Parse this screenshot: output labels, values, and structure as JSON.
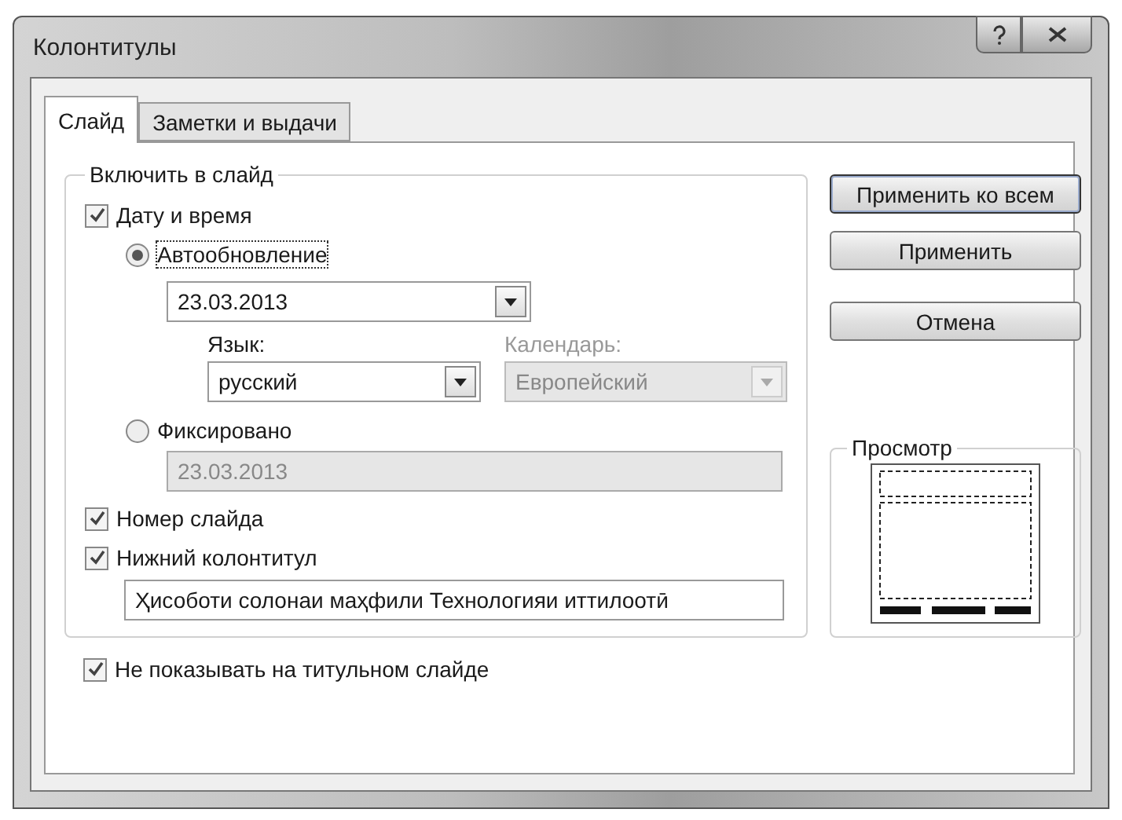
{
  "window": {
    "title": "Колонтитулы"
  },
  "tabs": [
    {
      "label": "Слайд",
      "selected": true
    },
    {
      "label": "Заметки и выдачи",
      "selected": false
    }
  ],
  "include_group": {
    "title": "Включить в слайд",
    "date_time": {
      "label": "Дату и время",
      "checked": true
    },
    "auto_update": {
      "label": "Автообновление",
      "selected": true
    },
    "auto_date": {
      "value": "23.03.2013"
    },
    "language": {
      "label": "Язык:",
      "value": "русский",
      "disabled": false
    },
    "calendar": {
      "label": "Календарь:",
      "value": "Европейский",
      "disabled": true
    },
    "fixed": {
      "label": "Фиксировано",
      "selected": false
    },
    "fixed_date": {
      "value": "23.03.2013",
      "disabled": true
    },
    "slide_number": {
      "label": "Номер слайда",
      "checked": true
    },
    "footer": {
      "label": "Нижний колонтитул",
      "checked": true
    },
    "footer_text": {
      "value": "Ҳисоботи солонаи маҳфили Технологияи иттилоотӣ"
    }
  },
  "dont_show_on_title": {
    "label": "Не показывать на титульном слайде",
    "checked": true
  },
  "buttons": [
    {
      "label": "Применить ко всем",
      "default": true
    },
    {
      "label": "Применить",
      "default": false
    },
    {
      "label": "Отмена",
      "default": false
    }
  ],
  "preview": {
    "title": "Просмотр"
  }
}
